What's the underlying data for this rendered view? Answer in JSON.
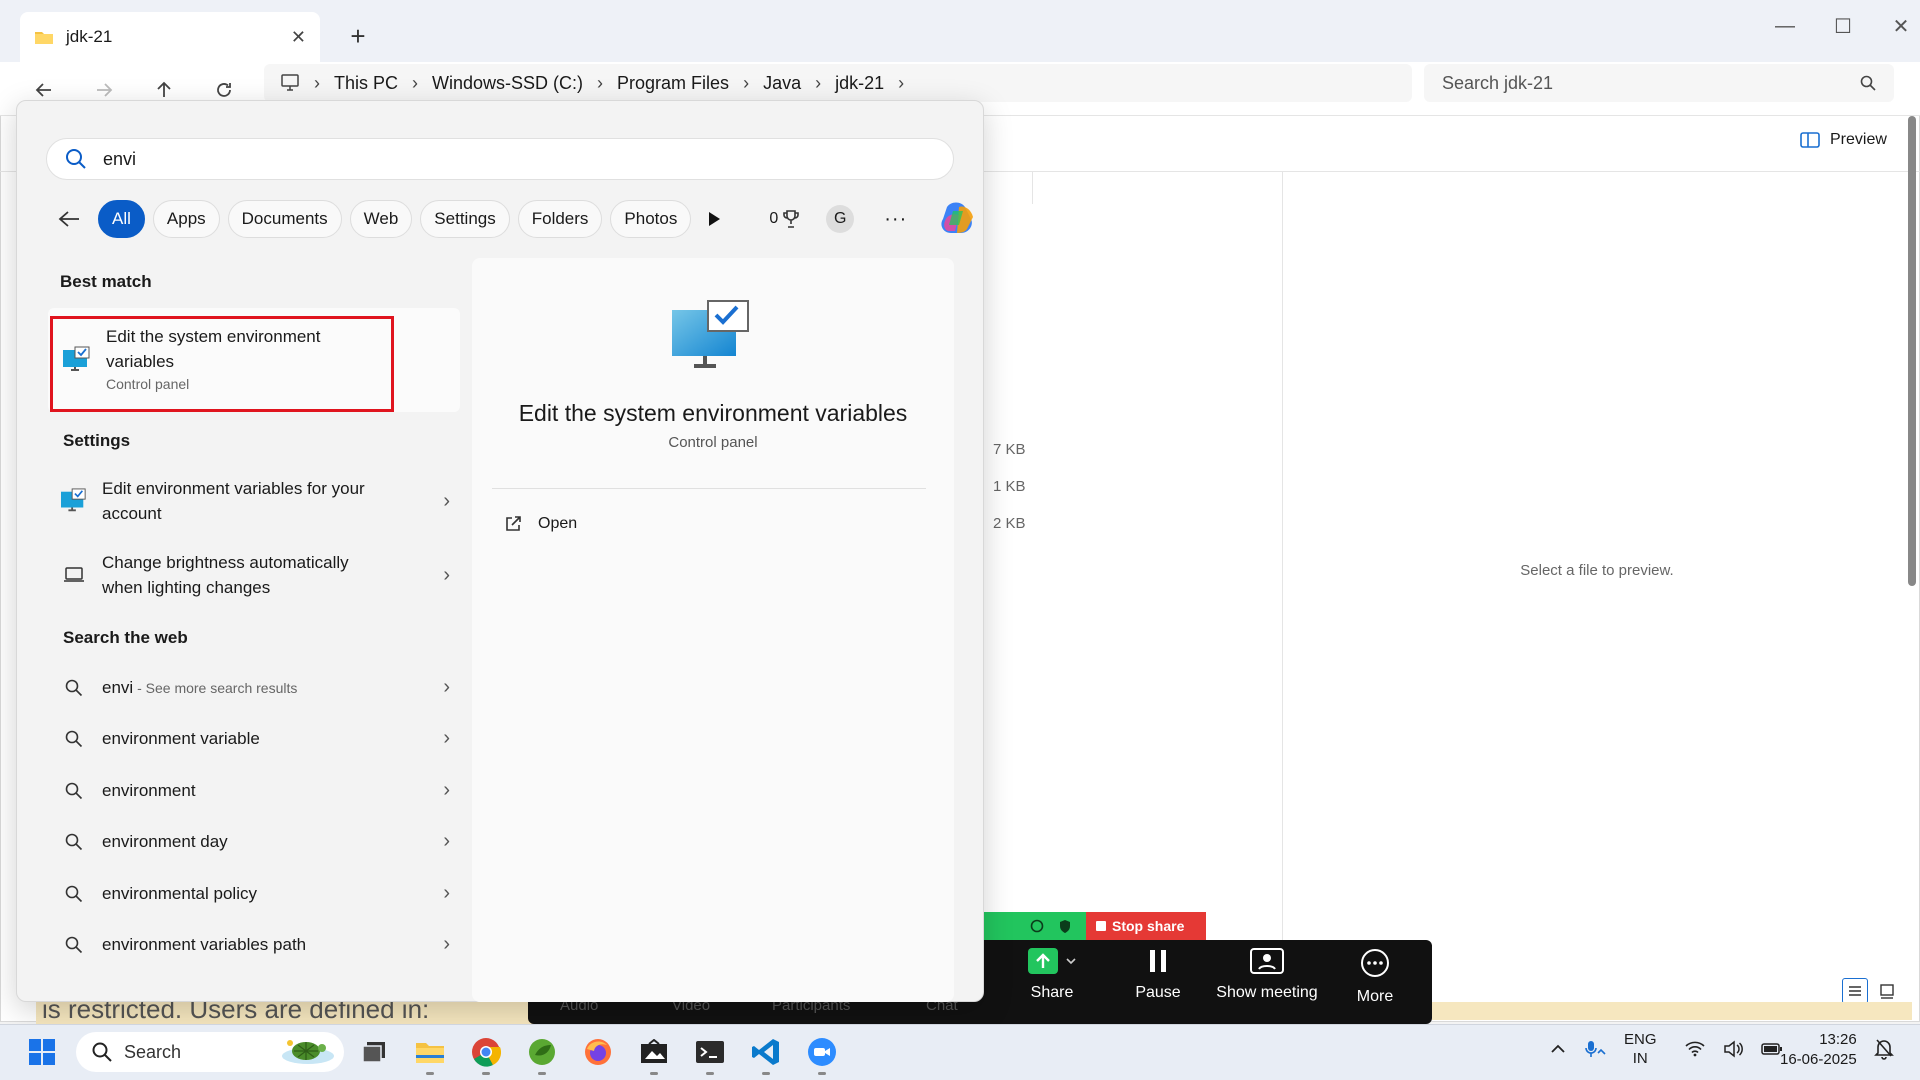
{
  "explorer": {
    "tab_title": "jdk-21",
    "breadcrumb": [
      "This PC",
      "Windows-SSD (C:)",
      "Program Files",
      "Java",
      "jdk-21"
    ],
    "search_placeholder": "Search jdk-21",
    "preview_label": "Preview",
    "file_sizes": [
      "7 KB",
      "1 KB",
      "2 KB"
    ],
    "preview_message": "Select a file to preview."
  },
  "search": {
    "query": "envi",
    "chips": [
      "All",
      "Apps",
      "Documents",
      "Web",
      "Settings",
      "Folders",
      "Photos"
    ],
    "points": "0",
    "avatar": "G",
    "best_match_heading": "Best match",
    "best_match": {
      "title": "Edit the system environment variables",
      "subtitle": "Control panel"
    },
    "settings_heading": "Settings",
    "settings_items": [
      "Edit environment variables for your account",
      "Change brightness automatically when lighting changes"
    ],
    "web_heading": "Search the web",
    "web_first": {
      "query": "envi",
      "hint": "See more search results"
    },
    "web_items": [
      "environment variable",
      "environment",
      "environment day",
      "environmental policy",
      "environment variables path"
    ],
    "preview": {
      "title": "Edit the system environment variables",
      "subtitle": "Control panel",
      "open_label": "Open"
    }
  },
  "zoom": {
    "stop_share": "Stop share",
    "buttons": [
      "Share",
      "Pause",
      "Show meeting",
      "More"
    ],
    "faint_labels": [
      "Audio",
      "Video",
      "Participants",
      "Chat"
    ]
  },
  "background_text": "is restricted. Users are defined in:",
  "taskbar": {
    "search_label": "Search",
    "lang": "ENG",
    "region": "IN",
    "time": "13:26",
    "date": "16-06-2025"
  },
  "colors": {
    "accent": "#0a5cc7",
    "highlight_border": "#e0141e",
    "zoom_green": "#22c55e",
    "zoom_red": "#e53935"
  }
}
